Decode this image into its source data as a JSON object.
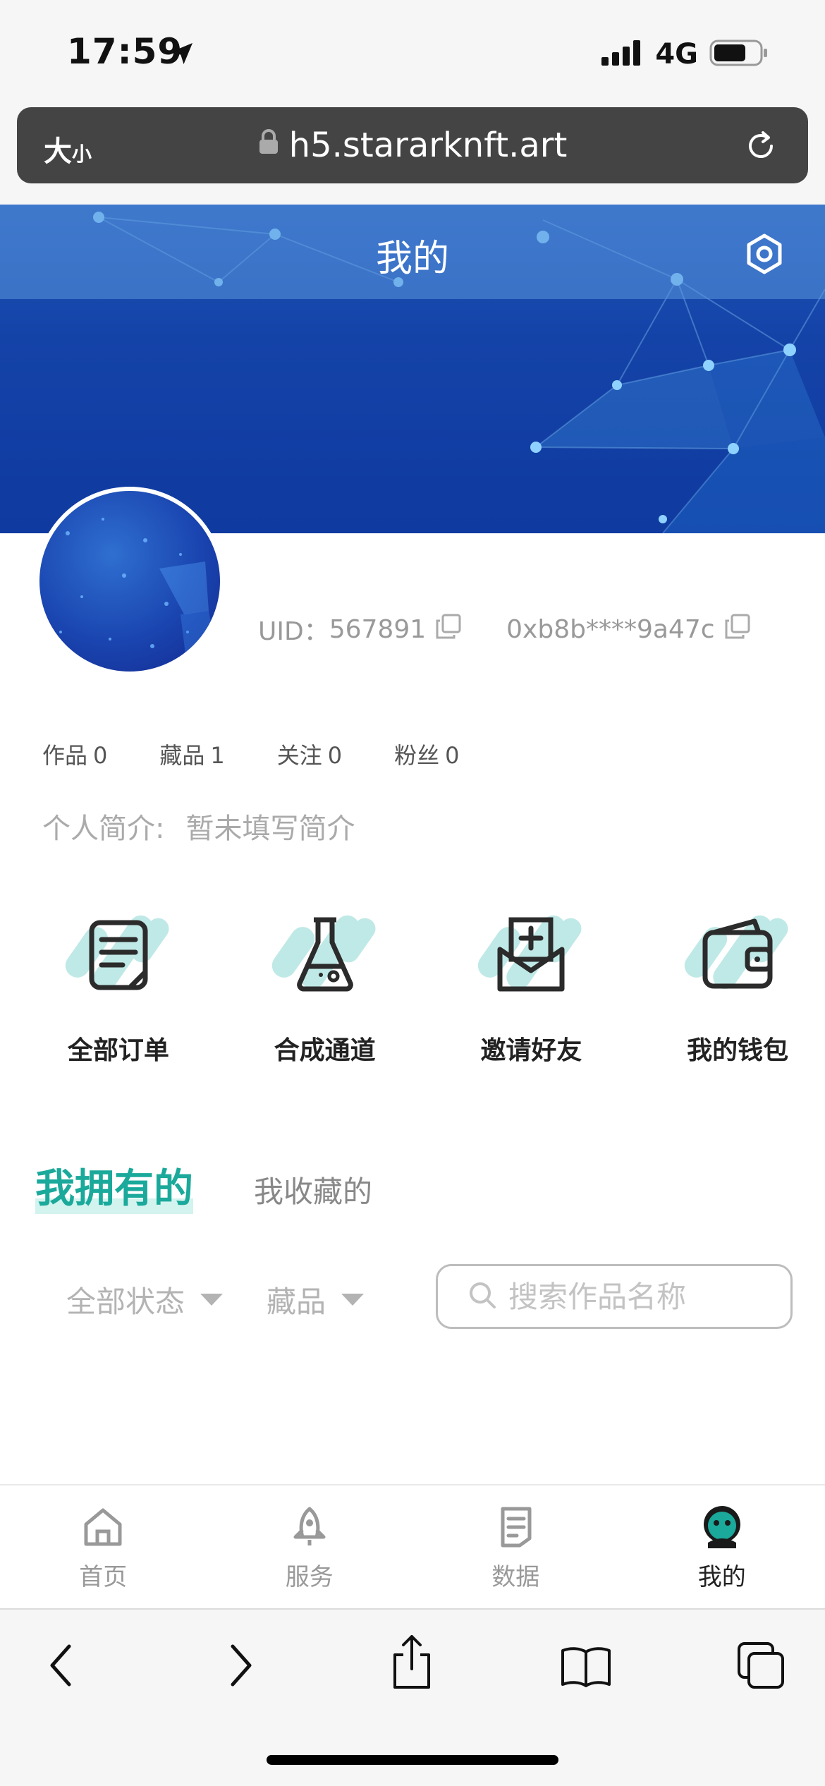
{
  "status_bar": {
    "time": "17:59",
    "network": "4G"
  },
  "browser": {
    "text_size_label": "大",
    "text_size_small": "小",
    "url": "h5.stararknft.art"
  },
  "header": {
    "title": "我的"
  },
  "profile": {
    "uid_label": "UID：",
    "uid": "567891",
    "wallet": "0xb8b****9a47c",
    "stats": [
      {
        "label": "作品",
        "value": "0"
      },
      {
        "label": "藏品",
        "value": "1"
      },
      {
        "label": "关注",
        "value": "0"
      },
      {
        "label": "粉丝",
        "value": "0"
      }
    ],
    "bio_label": "个人简介:",
    "bio": "暂未填写简介"
  },
  "quick_actions": [
    {
      "label": "全部订单",
      "icon": "order-list-icon"
    },
    {
      "label": "合成通道",
      "icon": "flask-icon"
    },
    {
      "label": "邀请好友",
      "icon": "invite-icon"
    },
    {
      "label": "我的钱包",
      "icon": "wallet-icon"
    }
  ],
  "collection_tabs": {
    "active": "我拥有的",
    "other": "我收藏的"
  },
  "filters": {
    "status": "全部状态",
    "type": "藏品",
    "search_placeholder": "搜索作品名称"
  },
  "tabbar": [
    {
      "label": "首页",
      "icon": "home-icon",
      "active": false
    },
    {
      "label": "服务",
      "icon": "rocket-icon",
      "active": false
    },
    {
      "label": "数据",
      "icon": "report-icon",
      "active": false
    },
    {
      "label": "我的",
      "icon": "robot-avatar-icon",
      "active": true
    }
  ],
  "colors": {
    "accent": "#1aa99a",
    "hero": "#1443a8",
    "nav_bar": "#444444"
  }
}
